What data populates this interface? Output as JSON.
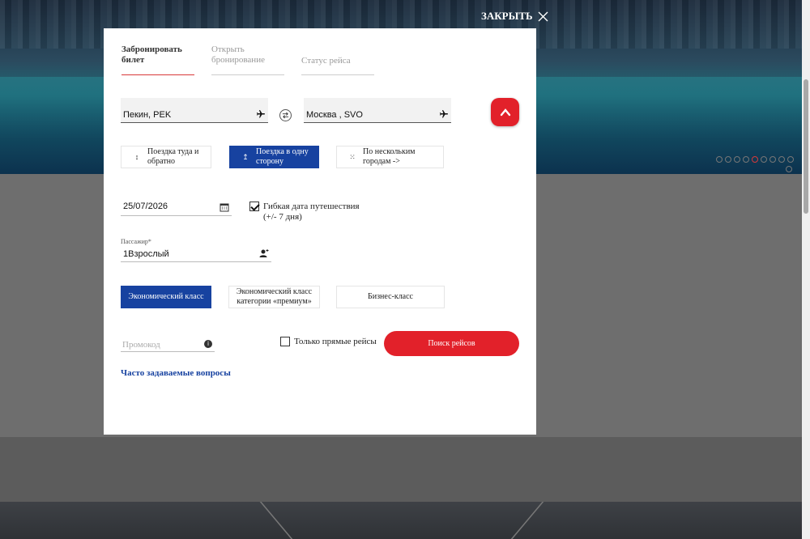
{
  "close": {
    "label": "ЗАКРЫТЬ"
  },
  "tabs": [
    {
      "line1": "Забронировать",
      "line2": "билет"
    },
    {
      "line1": "Открыть",
      "line2": "бронирование"
    },
    {
      "line1": "Статус рейса",
      "line2": ""
    }
  ],
  "route": {
    "from": "Пекин, PEK",
    "to": "Москва , SVO"
  },
  "trip_types": [
    {
      "line1": "Поездка туда и",
      "line2": "обратно",
      "icon": "↕"
    },
    {
      "line1": "Поездка в одну",
      "line2": "сторону",
      "icon": "↥"
    },
    {
      "line1": "По нескольким",
      "line2": "городам ->",
      "icon": "⁙"
    }
  ],
  "date": {
    "value": "25/07/2026"
  },
  "flex_date": {
    "line1": "Гибкая дата путешествия",
    "line2": "(+/- 7 дня)",
    "checked": true
  },
  "passenger": {
    "label": "Пассажир*",
    "value": "1Взрослый"
  },
  "classes": [
    {
      "line1": "Экономический класс",
      "line2": ""
    },
    {
      "line1": "Экономический класс",
      "line2": "категории «премиум»"
    },
    {
      "line1": "Бизнес-класс",
      "line2": ""
    }
  ],
  "promo": {
    "placeholder": "Промокод"
  },
  "direct": {
    "label": "Только прямые рейсы",
    "checked": false
  },
  "search": {
    "label": "Поиск рейсов"
  },
  "faq": {
    "label": "Часто задаваемые вопросы"
  },
  "colors": {
    "accent_red": "#e2212a",
    "accent_blue": "#1742a0"
  }
}
